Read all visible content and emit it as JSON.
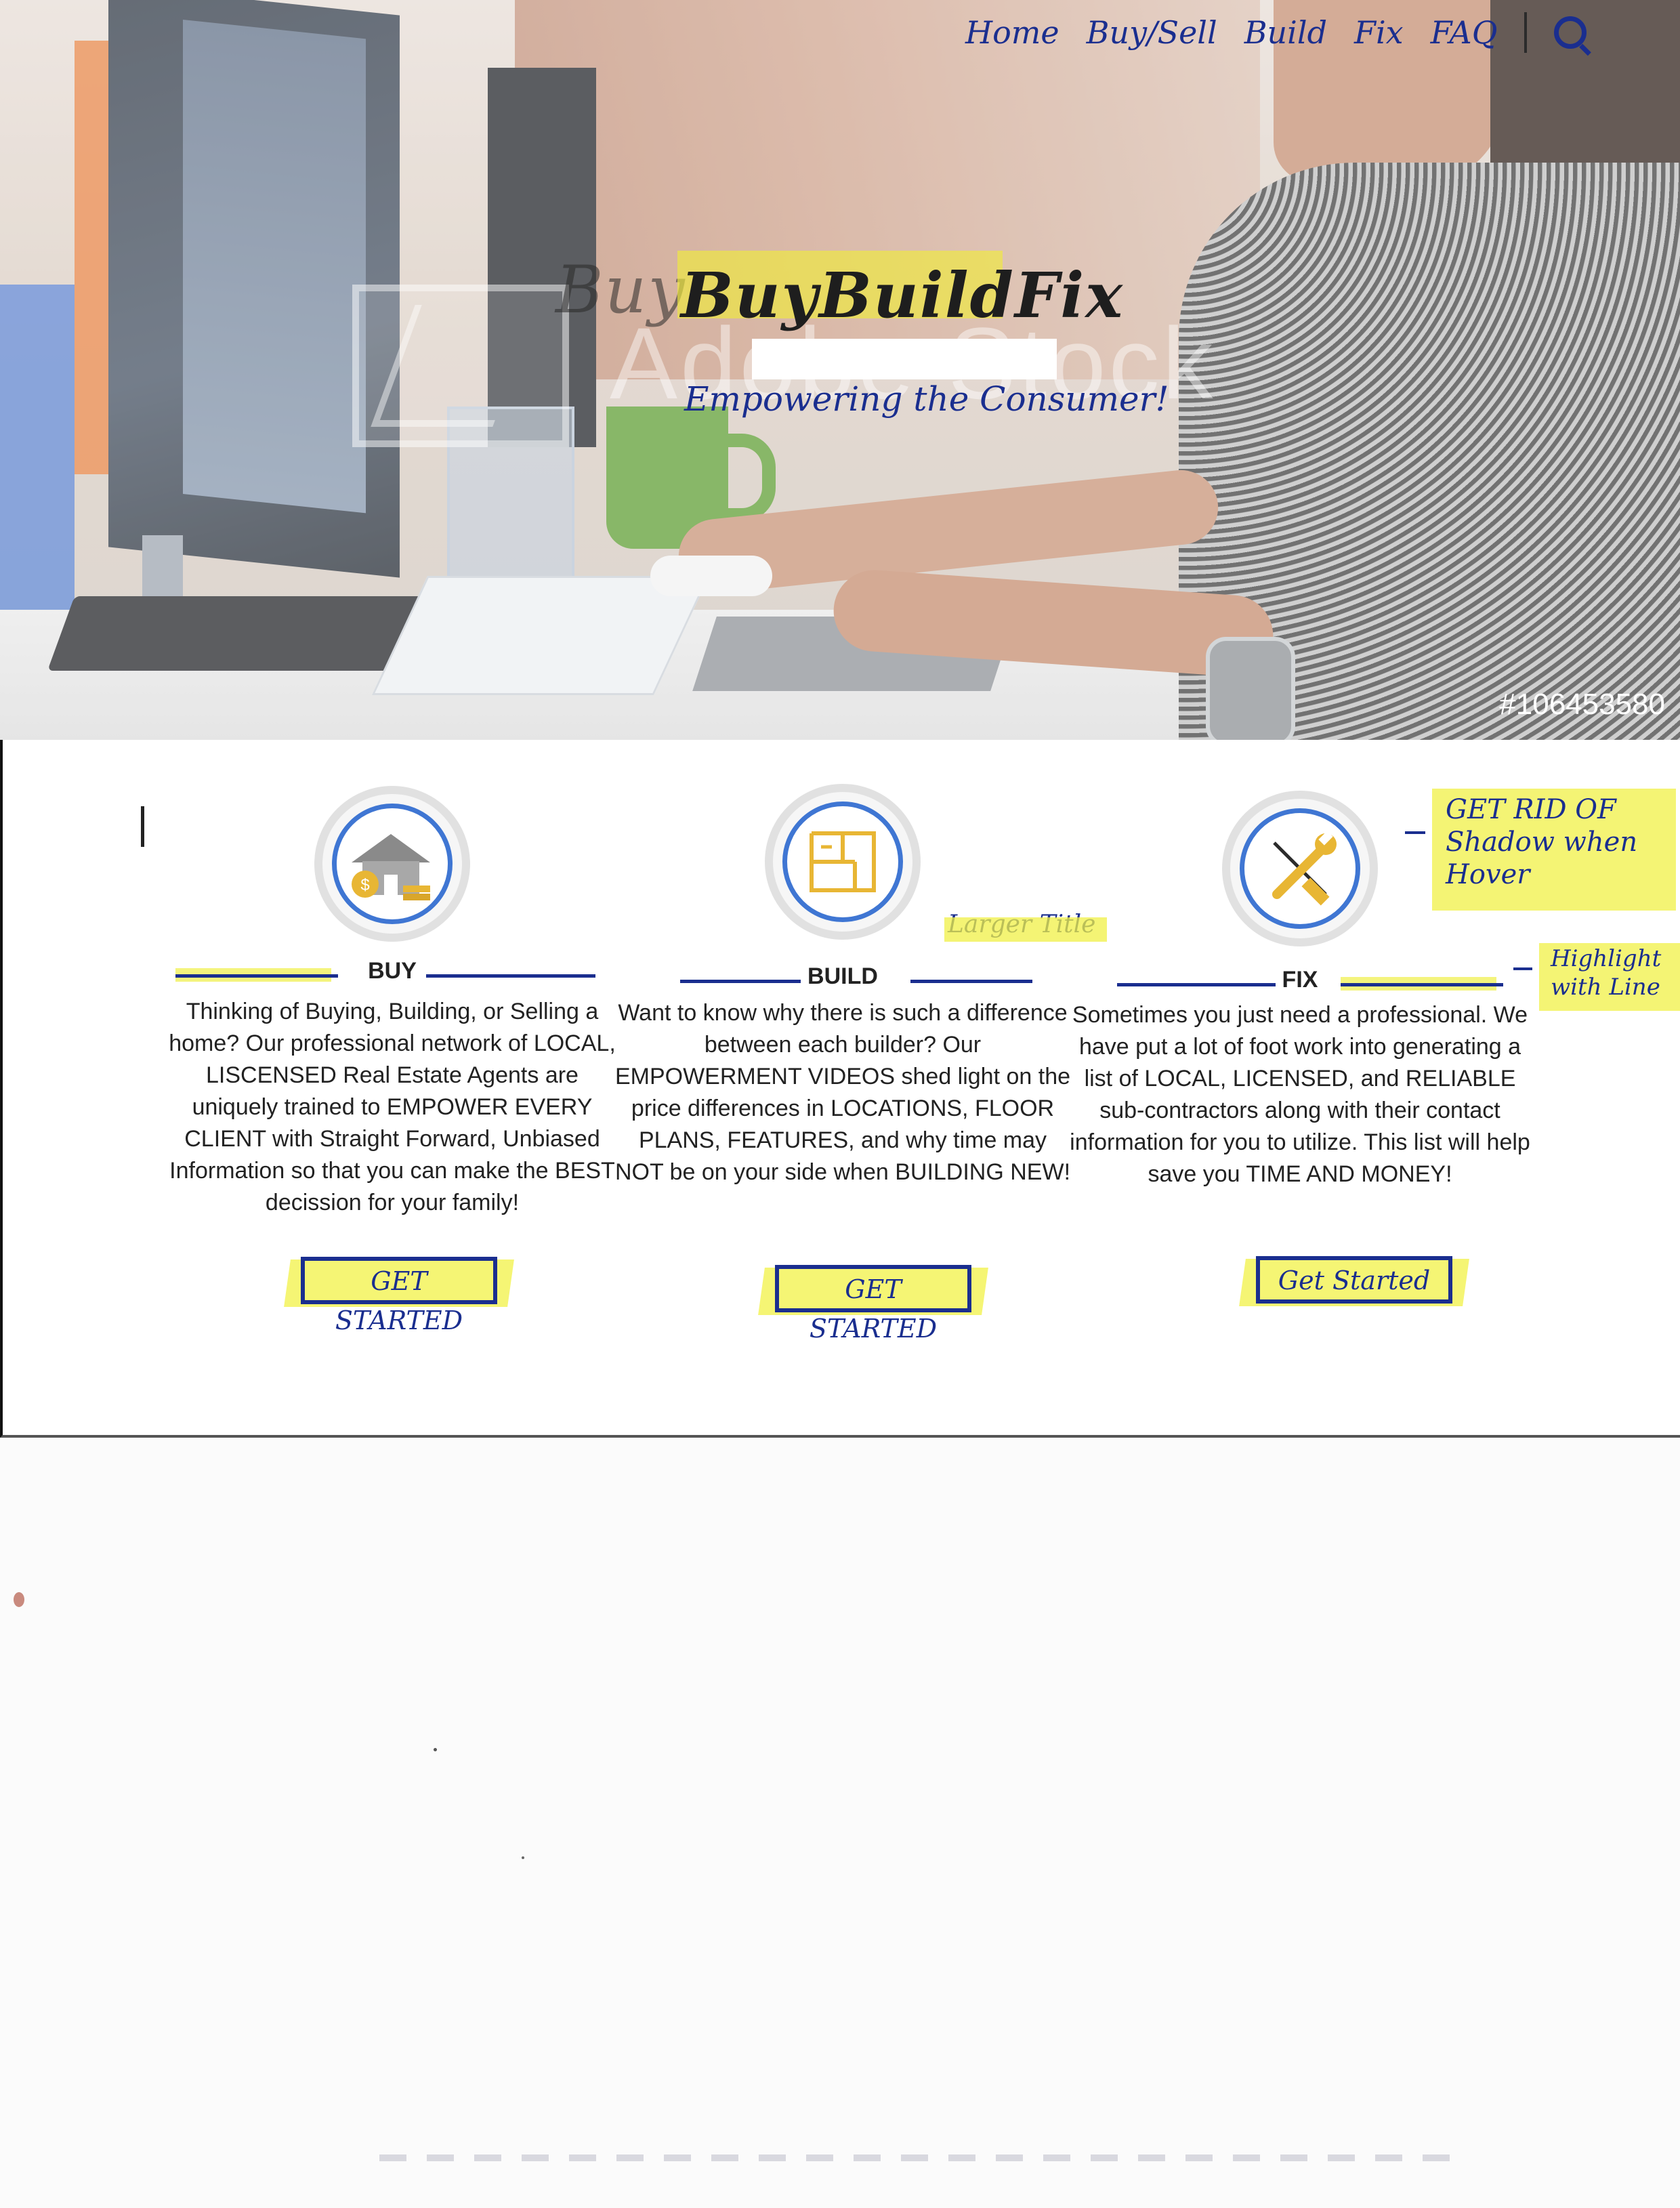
{
  "nav": {
    "items": [
      "Home",
      "Buy/Sell",
      "Build",
      "Fix",
      "FAQ"
    ],
    "search_icon": "search-icon"
  },
  "hero": {
    "brand_ghost": "Buy",
    "brand": "BuyBuildFix",
    "tagline": "Empowering the Consumer!",
    "watermark": "Adobe Stock",
    "stock_id": "#106453580"
  },
  "sections": [
    {
      "icon": "house-money-icon",
      "title": "BUY",
      "description": "Thinking of Buying, Building, or Selling a home? Our professional network of LOCAL, LISCENSED Real Estate Agents are uniquely trained to EMPOWER EVERY CLIENT with Straight Forward, Unbiased Information so that you can make the BEST decission for your family!",
      "button": "GET STARTED"
    },
    {
      "icon": "floor-plan-icon",
      "title": "BUILD",
      "description": "Want to know why there is such a difference between each builder? Our EMPOWERMENT VIDEOS shed light on the price differences in LOCATIONS, FLOOR PLANS, FEATURES, and why time may NOT be on your side when BUILDING NEW!",
      "button": "GET STARTED"
    },
    {
      "icon": "tools-icon",
      "title": "FIX",
      "description": "Sometimes you just need a professional. We have put a lot of foot work into generating a list of LOCAL, LICENSED, and RELIABLE sub-contractors along with their contact information for you to utilize. This list will help save you TIME AND MONEY!",
      "button": "Get Started"
    }
  ],
  "annotations": {
    "larger_title": "Larger Title",
    "shadow_note": [
      "GET RID OF",
      "Shadow when",
      "Hover"
    ],
    "highlight_note": [
      "Highlight",
      "with Line"
    ]
  },
  "colors": {
    "ink_blue": "#1a2e8f",
    "icon_ring_blue": "#3f76d3",
    "highlighter_yellow": "#f0f046",
    "icon_gold": "#e8b634"
  }
}
